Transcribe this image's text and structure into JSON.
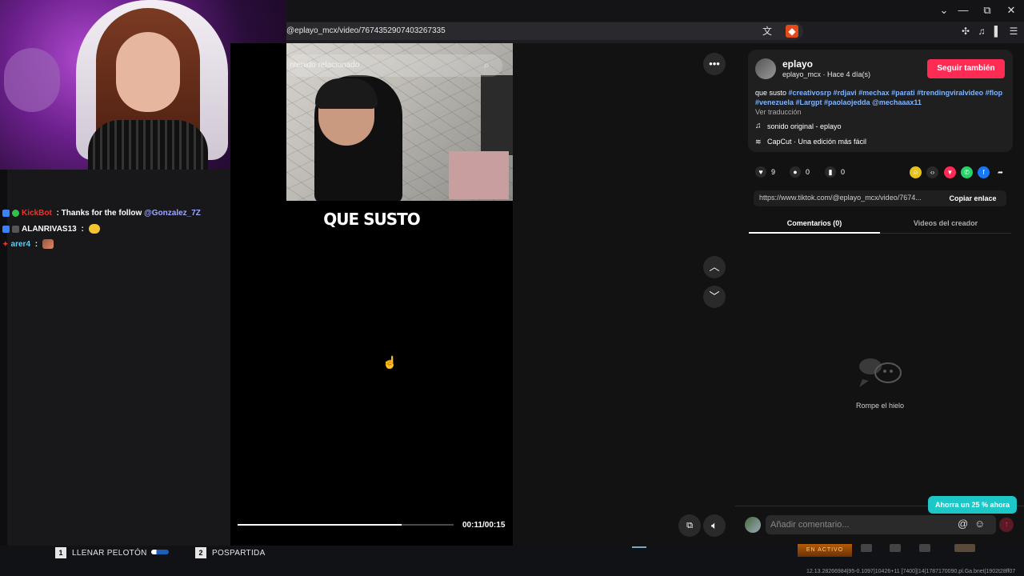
{
  "browser": {
    "url": "@eplayo_mcx/video/7674352907403267335",
    "window_buttons": [
      "⌄",
      "—",
      "⧉",
      "✕"
    ]
  },
  "chat": {
    "messages": [
      {
        "user": "KickBot",
        "text": " : Thanks for the follow ",
        "mention": "@Gonzalez_7Z",
        "user_color": "#e8342f"
      },
      {
        "user": "ALANRIVAS13",
        "text": " : ",
        "emote": "emote-hug",
        "user_color": "#ffffff"
      },
      {
        "user": "arer4",
        "text": " : ",
        "emote": "emote-img",
        "user_color": "#4fd2ff"
      }
    ]
  },
  "video": {
    "related_placeholder": "ntenido relacionado",
    "title": "QUE SUSTO",
    "time": "00:11/00:15",
    "progress": 0.76
  },
  "post": {
    "author": "eplayo",
    "author_sub": "eplayo_mcx · Hace 4 día(s)",
    "follow_label": "Seguir también",
    "desc_text": "que susto ",
    "desc_tags": "#creativosrp #rdjavi #mechax #parati #trendingviralvideo #flop #venezuela #Largpt #paolaojedda @mechaaax11",
    "translate": "Ver traducción",
    "sound": "sonido original - eplayo",
    "capcut": "CapCut · Una edición más fácil",
    "likes": "9",
    "comments": "0",
    "saves": "0",
    "link": "https://www.tiktok.com/@eplayo_mcx/video/7674...",
    "copy_label": "Copiar enlace",
    "tab_comments": "Comentarios (0)",
    "tab_videos": "Videos del creador",
    "empty_text": "Rompe el hielo",
    "comment_placeholder": "Añadir comentario...",
    "promo": "Ahorra un 25 % ahora"
  },
  "hud": {
    "key1": "1",
    "label1": "LLENAR PELOTÓN",
    "key2": "2",
    "label2": "POSPARTIDA",
    "status": "EN ACTIVO",
    "coords": "12.13.28266984|95-0.1097|10426+11 [7400]|14|1787170090.pl.Ga.bnet|1902t28ff07"
  },
  "colors": {
    "follow": "#fe2c55",
    "promo": "#1bc7c7",
    "hashtag": "#7fb3ff"
  }
}
